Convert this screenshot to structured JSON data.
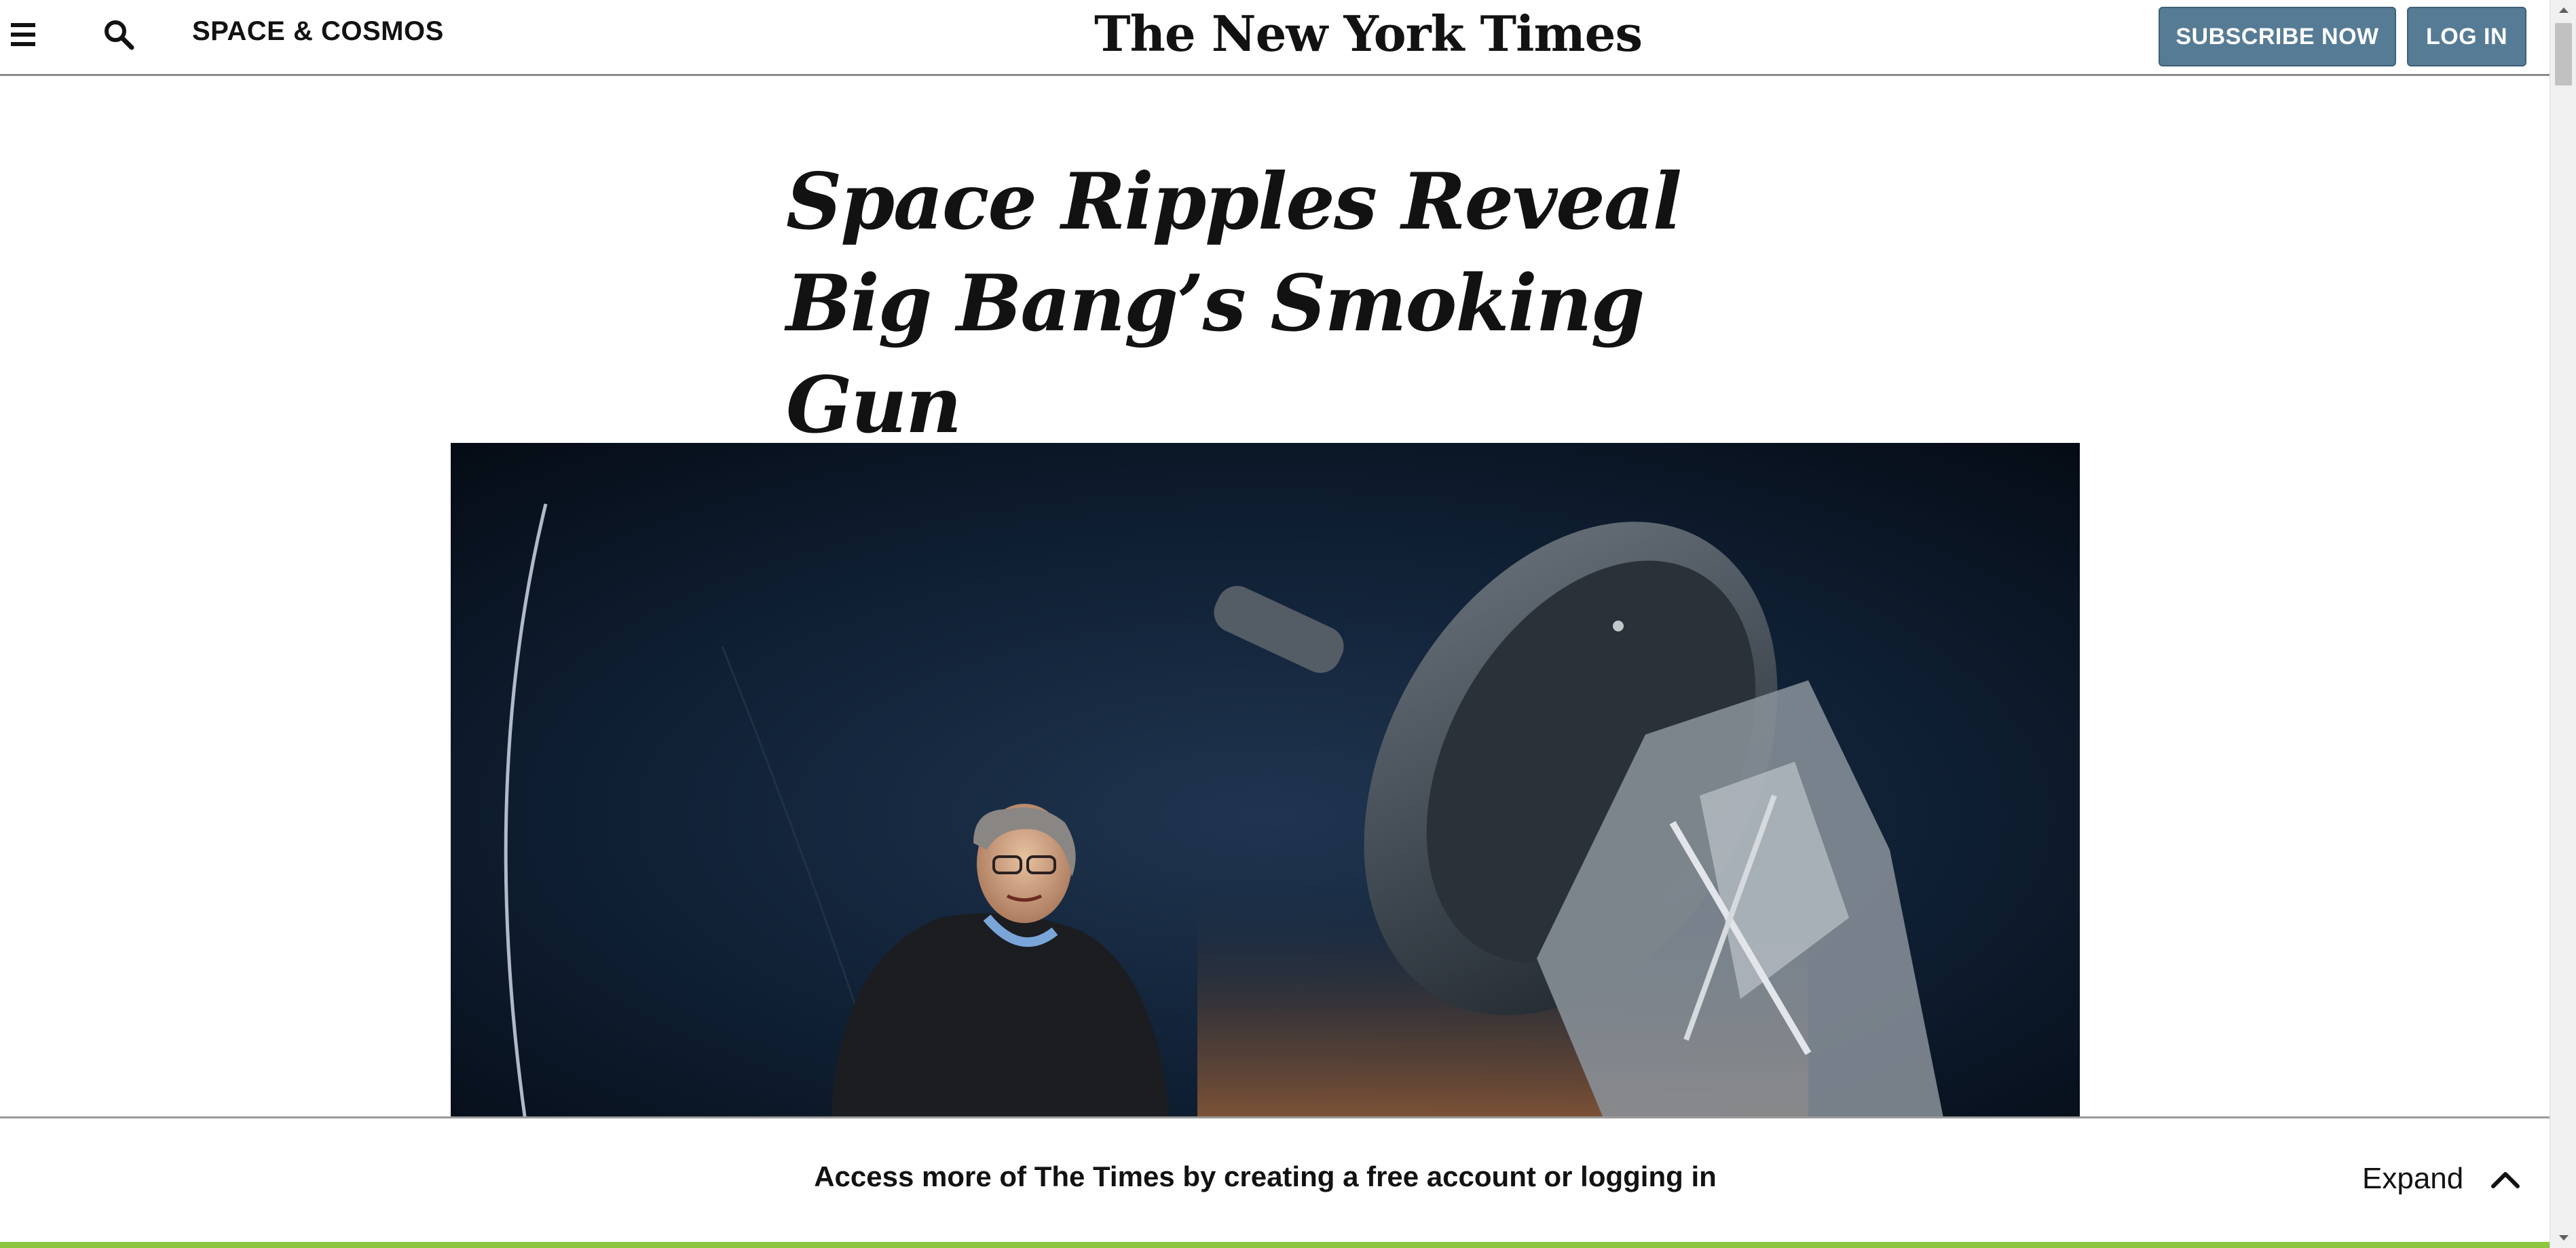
{
  "header": {
    "section_label": "SPACE & COSMOS",
    "logo_text": "The New York Times",
    "subscribe_label": "SUBSCRIBE NOW",
    "login_label": "LOG IN",
    "menu_icon": "hamburger-menu-icon",
    "search_icon": "search-icon"
  },
  "article": {
    "headline": "Space Ripples Reveal Big Bang’s Smoking Gun",
    "hero_image_alt": "Man in a dark jacket standing beside a large telescope at dusk"
  },
  "banner": {
    "message": "Access more of The Times by creating a free account or logging in",
    "expand_label": "Expand",
    "expand_icon": "chevron-up-icon"
  },
  "colors": {
    "button_bg": "#567b95",
    "accent_strip": "#8dc63f",
    "text": "#121212"
  }
}
